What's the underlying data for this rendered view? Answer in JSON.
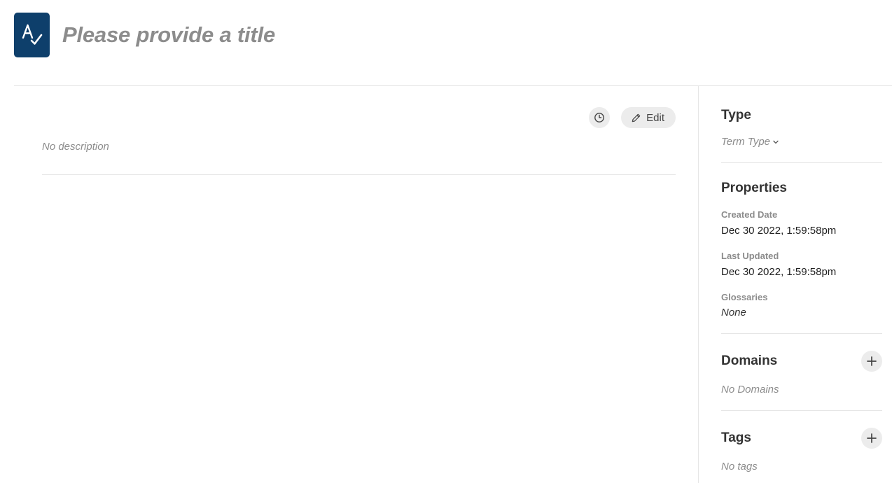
{
  "header": {
    "title": "Please provide a title",
    "logo_icon": "glossary-term-icon"
  },
  "main": {
    "history_icon": "clock-icon",
    "edit_label": "Edit",
    "description": "No description"
  },
  "sidebar": {
    "type": {
      "title": "Type",
      "value": "Term Type"
    },
    "properties": {
      "title": "Properties",
      "created_label": "Created Date",
      "created_value": "Dec 30 2022, 1:59:58pm",
      "updated_label": "Last Updated",
      "updated_value": "Dec 30 2022, 1:59:58pm",
      "glossaries_label": "Glossaries",
      "glossaries_value": "None"
    },
    "domains": {
      "title": "Domains",
      "empty": "No Domains"
    },
    "tags": {
      "title": "Tags",
      "empty": "No tags"
    }
  },
  "colors": {
    "logo_bg": "#0e3f6b",
    "button_bg": "#ececec",
    "muted_text": "#8c8c8c",
    "divider": "#e6e6e6"
  }
}
